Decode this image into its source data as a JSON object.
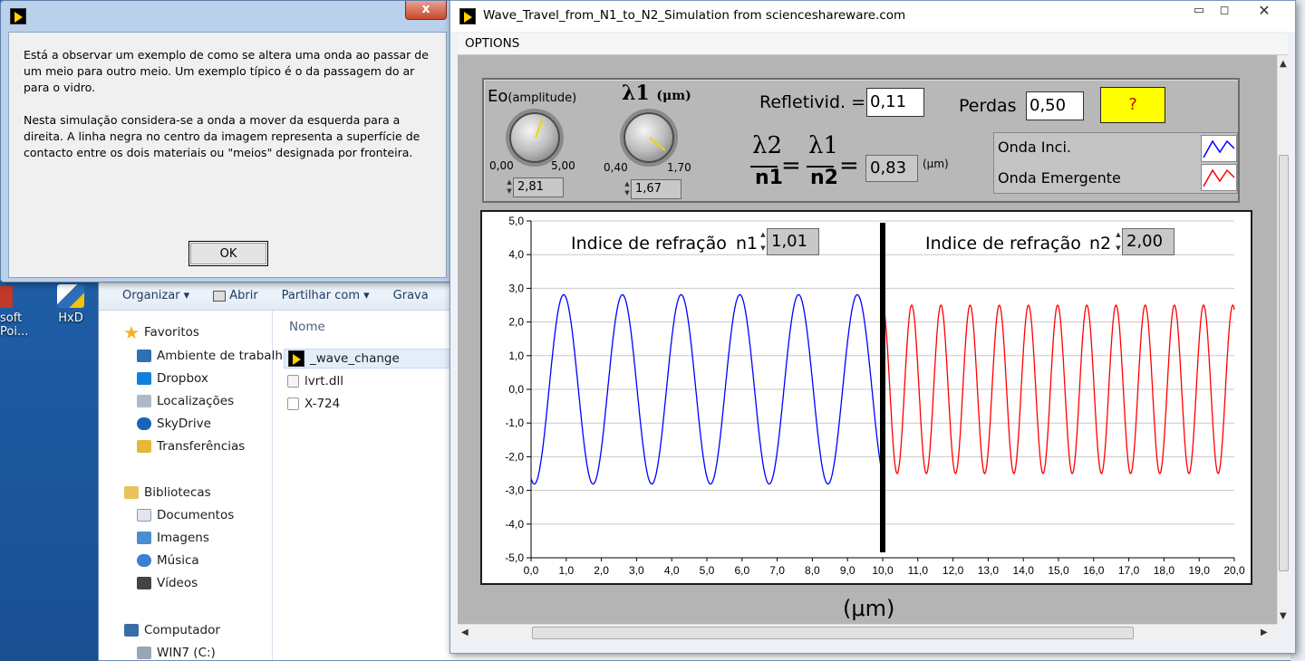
{
  "desktop": {
    "icons": [
      {
        "label": "soft\nPoi...",
        "name": "powerpoint"
      },
      {
        "label": "HxD",
        "name": "hxd"
      }
    ]
  },
  "explorer": {
    "toolbar": [
      "Organizar ▾",
      "Abrir",
      "Partilhar com ▾",
      "Grava"
    ],
    "nav": [
      {
        "label": "Favoritos",
        "icon": "star-icon",
        "indent": 0,
        "y": 0
      },
      {
        "label": "Ambiente de trabalh",
        "icon": "desktop-icon",
        "indent": 1
      },
      {
        "label": "Dropbox",
        "icon": "dropbox-icon",
        "indent": 1
      },
      {
        "label": "Localizações",
        "icon": "places-icon",
        "indent": 1
      },
      {
        "label": "SkyDrive",
        "icon": "cloud-icon",
        "indent": 1
      },
      {
        "label": "Transferências",
        "icon": "downloads-icon",
        "indent": 1
      },
      {
        "label": "Bibliotecas",
        "icon": "library-icon",
        "indent": 0
      },
      {
        "label": "Documentos",
        "icon": "documents-icon",
        "indent": 1
      },
      {
        "label": "Imagens",
        "icon": "images-icon",
        "indent": 1
      },
      {
        "label": "Música",
        "icon": "music-icon",
        "indent": 1
      },
      {
        "label": "Vídeos",
        "icon": "videos-icon",
        "indent": 1
      },
      {
        "label": "Computador",
        "icon": "computer-icon",
        "indent": 0
      },
      {
        "label": "WIN7 (C:)",
        "icon": "drive-icon",
        "indent": 1
      }
    ],
    "files_header": "Nome",
    "files": [
      "_wave_change",
      "lvrt.dll",
      "X-724"
    ]
  },
  "dialog": {
    "close_label": "x",
    "para1": "Está a observar um exemplo de como se altera uma onda ao passar de um meio para outro meio. Um exemplo típico é o da passagem do ar para o vidro.",
    "para2": "Nesta simulação considera-se a onda a mover da esquerda para a direita. A linha negra no centro da imagem representa a superfície de contacto entre os dois materiais ou \"meios\" designada por fronteira.",
    "ok_label": "OK"
  },
  "app": {
    "title": "Wave_Travel_from_N1_to_N2_Simulation from scienceshareware.com",
    "menu": "OPTIONS",
    "eo_label_main": "Eo",
    "eo_label_sub": "(amplitude)",
    "eo_min": "0,00",
    "eo_max": "5,00",
    "eo_value": "2,81",
    "lambda1_label": "λ1",
    "lambda1_unit": "(μm)",
    "lambda1_min": "0,40",
    "lambda1_max": "1,70",
    "lambda1_value": "1,67",
    "refl_label": "Refletivid. =",
    "refl_value": "0,11",
    "perdas_label": "Perdas",
    "perdas_value": "0,50",
    "help_label": "?",
    "formula": {
      "lambda2": "λ2",
      "n1": "n1",
      "lambda1": "λ1",
      "n2": "n2",
      "eq": "=",
      "result": "0,83",
      "unit": "(μm)"
    },
    "legend": [
      {
        "label": "Onda Inci.",
        "color": "#0000ff"
      },
      {
        "label": "Onda Emergente",
        "color": "#ff0000"
      }
    ],
    "n1_label": "Indice de refração",
    "n1_name": "n1",
    "n1_value": "1,01",
    "n2_label": "Indice de refração",
    "n2_name": "n2",
    "n2_value": "2,00",
    "x_unit": "(μm)"
  },
  "chart_data": {
    "type": "line",
    "xlim": [
      0,
      20
    ],
    "ylim": [
      -5,
      5
    ],
    "x_ticks": [
      "0,0",
      "1,0",
      "2,0",
      "3,0",
      "4,0",
      "5,0",
      "6,0",
      "7,0",
      "8,0",
      "9,0",
      "10,0",
      "11,0",
      "12,0",
      "13,0",
      "14,0",
      "15,0",
      "16,0",
      "17,0",
      "18,0",
      "19,0",
      "20,0"
    ],
    "y_ticks": [
      "5,0",
      "4,0",
      "3,0",
      "2,0",
      "1,0",
      "0,0",
      "-1,0",
      "-2,0",
      "-3,0",
      "-4,0",
      "-5,0"
    ],
    "boundary_x": 10,
    "series": [
      {
        "name": "Onda Inci.",
        "color": "#0000ff",
        "amplitude": 2.81,
        "wavelength": 1.67,
        "x_range": [
          0,
          10
        ]
      },
      {
        "name": "Onda Emergente",
        "color": "#ff0000",
        "amplitude": 2.5,
        "wavelength": 0.83,
        "x_range": [
          10,
          20
        ]
      }
    ],
    "grid": true
  }
}
